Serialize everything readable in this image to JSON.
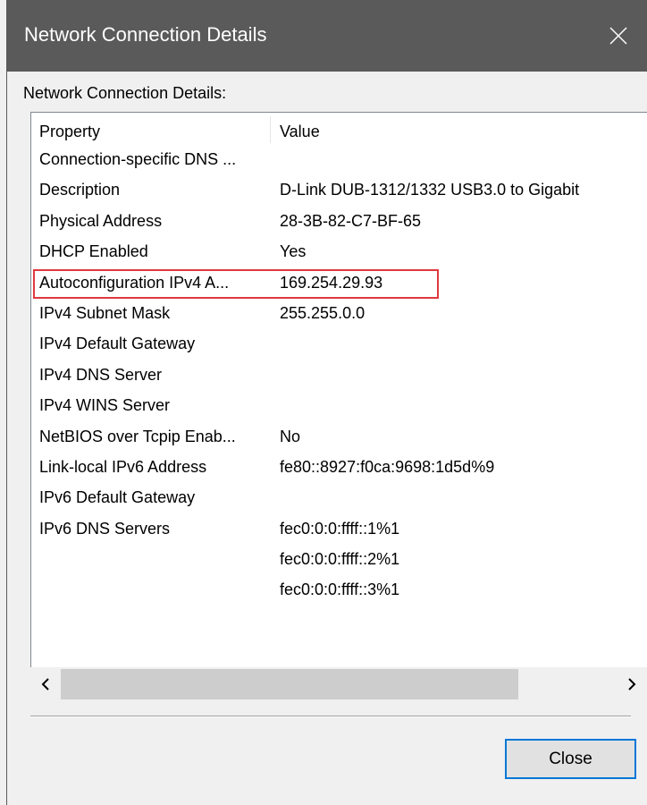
{
  "window": {
    "title": "Network Connection Details"
  },
  "group_label": "Network Connection Details:",
  "table": {
    "columns": [
      "Property",
      "Value"
    ],
    "rows": [
      {
        "property": "Connection-specific DNS ...",
        "value": ""
      },
      {
        "property": "Description",
        "value": "D-Link DUB-1312/1332 USB3.0 to Gigabit"
      },
      {
        "property": "Physical Address",
        "value": "28-3B-82-C7-BF-65"
      },
      {
        "property": "DHCP Enabled",
        "value": "Yes"
      },
      {
        "property": "Autoconfiguration IPv4 A...",
        "value": "169.254.29.93"
      },
      {
        "property": "IPv4 Subnet Mask",
        "value": "255.255.0.0"
      },
      {
        "property": "IPv4 Default Gateway",
        "value": ""
      },
      {
        "property": "IPv4 DNS Server",
        "value": ""
      },
      {
        "property": "IPv4 WINS Server",
        "value": ""
      },
      {
        "property": "NetBIOS over Tcpip Enab...",
        "value": "No"
      },
      {
        "property": "Link-local IPv6 Address",
        "value": "fe80::8927:f0ca:9698:1d5d%9"
      },
      {
        "property": "IPv6 Default Gateway",
        "value": ""
      },
      {
        "property": "IPv6 DNS Servers",
        "value": "fec0:0:0:ffff::1%1"
      },
      {
        "property": "",
        "value": "fec0:0:0:ffff::2%1"
      },
      {
        "property": "",
        "value": "fec0:0:0:ffff::3%1"
      }
    ]
  },
  "buttons": {
    "close_label": "Close"
  },
  "icons": {
    "title_close": "close-icon",
    "scroll_left": "chevron-left-icon",
    "scroll_right": "chevron-right-icon"
  },
  "colors": {
    "titlebar": "#5a5a5a",
    "highlight_border": "#e0393e",
    "button_focus_border": "#0078d7"
  }
}
